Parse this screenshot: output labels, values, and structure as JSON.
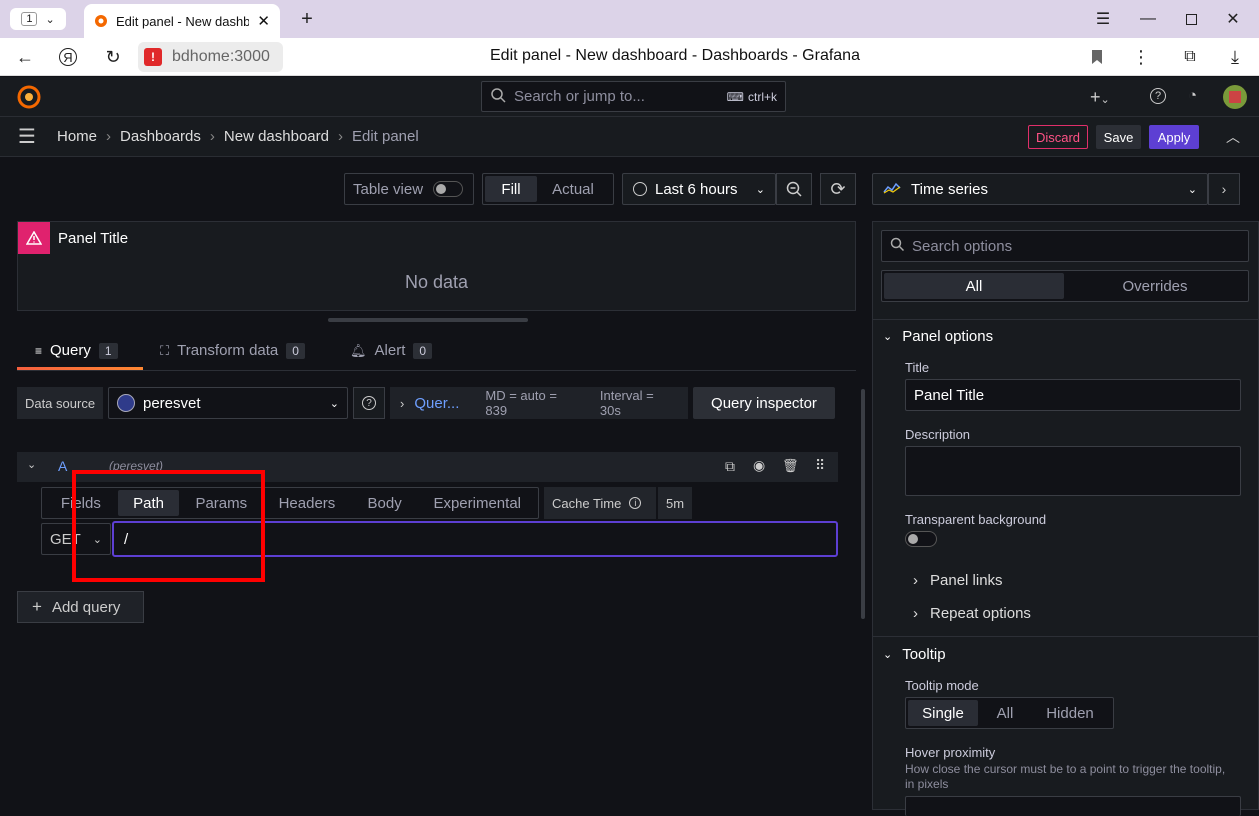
{
  "browser": {
    "tab_counter": "1",
    "tab_title": "Edit panel - New dashb",
    "url": "bdhome:3000",
    "page_title": "Edit panel - New dashboard - Dashboards - Grafana"
  },
  "topnav": {
    "search_placeholder": "Search or jump to...",
    "shortcut": "ctrl+k"
  },
  "breadcrumb": [
    "Home",
    "Dashboards",
    "New dashboard",
    "Edit panel"
  ],
  "actions": {
    "discard": "Discard",
    "save": "Save",
    "apply": "Apply"
  },
  "toolbar": {
    "table_view": "Table view",
    "fill": "Fill",
    "actual": "Actual",
    "time_range": "Last 6 hours",
    "visualization": "Time series"
  },
  "panel": {
    "title": "Panel Title",
    "no_data": "No data"
  },
  "query_tabs": [
    {
      "label": "Query",
      "count": "1"
    },
    {
      "label": "Transform data",
      "count": "0"
    },
    {
      "label": "Alert",
      "count": "0"
    }
  ],
  "datasource": {
    "label": "Data source",
    "value": "peresvet",
    "query_options": "Quer...",
    "md": "MD = auto = 839",
    "interval": "Interval = 30s",
    "inspector": "Query inspector"
  },
  "query_row": {
    "ref": "A",
    "ds_name": "(peresvet)",
    "tabs": [
      "Fields",
      "Path",
      "Params",
      "Headers",
      "Body",
      "Experimental"
    ],
    "active_tab": "Path",
    "cache_label": "Cache Time",
    "cache_value": "5m",
    "method": "GET",
    "path_value": "/",
    "add_query": "Add query"
  },
  "options": {
    "search_placeholder": "Search options",
    "all": "All",
    "overrides": "Overrides",
    "panel_options": "Panel options",
    "title_label": "Title",
    "title_value": "Panel Title",
    "description_label": "Description",
    "transparent_label": "Transparent background",
    "panel_links": "Panel links",
    "repeat_options": "Repeat options",
    "tooltip": "Tooltip",
    "tooltip_mode_label": "Tooltip mode",
    "tooltip_modes": [
      "Single",
      "All",
      "Hidden"
    ],
    "hover_label": "Hover proximity",
    "hover_desc": "How close the cursor must be to a point to trigger the tooltip, in pixels"
  },
  "colors": {
    "accent": "#6e9fff",
    "apply": "#5d3fd3",
    "discard": "#e02f6a",
    "highlight": "#ff0000"
  }
}
